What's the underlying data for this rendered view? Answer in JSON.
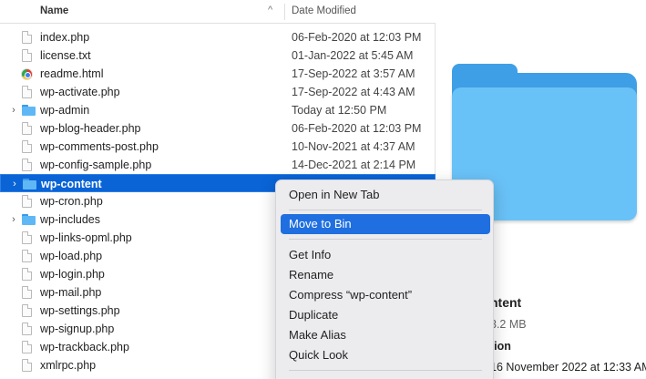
{
  "header": {
    "name_label": "Name",
    "sort_indicator": "^",
    "date_label": "Date Modified"
  },
  "files": [
    {
      "name": "index.php",
      "date": "06-Feb-2020 at 12:03 PM",
      "kind": "doc"
    },
    {
      "name": "license.txt",
      "date": "01-Jan-2022 at 5:45 AM",
      "kind": "doc"
    },
    {
      "name": "readme.html",
      "date": "17-Sep-2022 at 3:57 AM",
      "kind": "html"
    },
    {
      "name": "wp-activate.php",
      "date": "17-Sep-2022 at 4:43 AM",
      "kind": "doc"
    },
    {
      "name": "wp-admin",
      "date": "Today at 12:50 PM",
      "kind": "folder"
    },
    {
      "name": "wp-blog-header.php",
      "date": "06-Feb-2020 at 12:03 PM",
      "kind": "doc"
    },
    {
      "name": "wp-comments-post.php",
      "date": "10-Nov-2021 at 4:37 AM",
      "kind": "doc"
    },
    {
      "name": "wp-config-sample.php",
      "date": "14-Dec-2021 at 2:14 PM",
      "kind": "doc"
    },
    {
      "name": "wp-content",
      "date": "",
      "kind": "folder",
      "selected": true
    },
    {
      "name": "wp-cron.php",
      "date": "",
      "kind": "doc"
    },
    {
      "name": "wp-includes",
      "date": "",
      "kind": "folder"
    },
    {
      "name": "wp-links-opml.php",
      "date": "",
      "kind": "doc"
    },
    {
      "name": "wp-load.php",
      "date": "",
      "kind": "doc"
    },
    {
      "name": "wp-login.php",
      "date": "",
      "kind": "doc"
    },
    {
      "name": "wp-mail.php",
      "date": "",
      "kind": "doc"
    },
    {
      "name": "wp-settings.php",
      "date": "",
      "kind": "doc"
    },
    {
      "name": "wp-signup.php",
      "date": "",
      "kind": "doc"
    },
    {
      "name": "wp-trackback.php",
      "date": "",
      "kind": "doc"
    },
    {
      "name": "xmlrpc.php",
      "date": "",
      "kind": "doc"
    }
  ],
  "context_menu": {
    "open_in_new_tab": "Open in New Tab",
    "move_to_bin": "Move to Bin",
    "get_info": "Get Info",
    "rename": "Rename",
    "compress": "Compress “wp-content”",
    "duplicate": "Duplicate",
    "make_alias": "Make Alias",
    "quick_look": "Quick Look"
  },
  "preview": {
    "title": "ntent",
    "size": "3.2 MB",
    "section": "tion",
    "date": "16 November 2022 at 12:33 AM"
  },
  "colors": {
    "selection": "#0a64d6",
    "menu_highlight": "#1f6fe0",
    "folder_back": "#3f9fe6",
    "folder_front": "#69c2f7"
  }
}
